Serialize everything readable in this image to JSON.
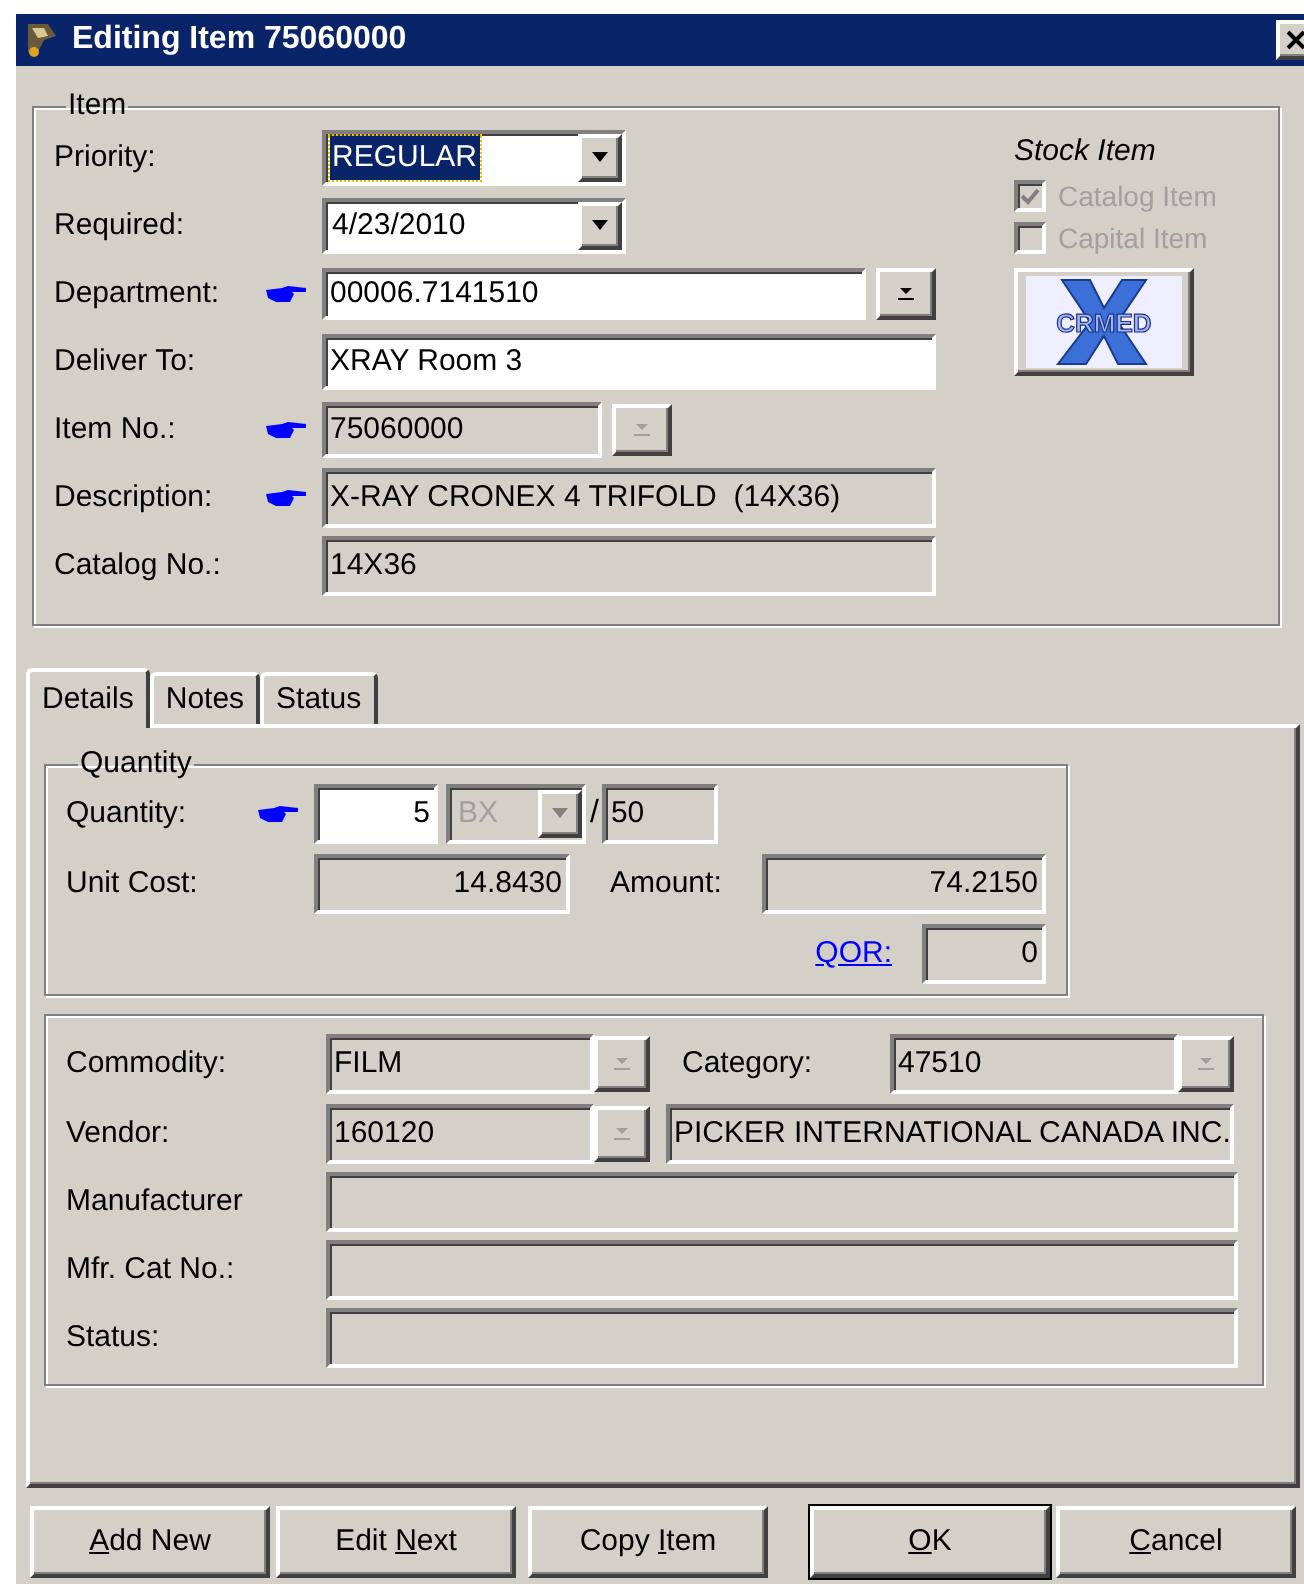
{
  "window": {
    "title": "Editing Item 75060000"
  },
  "item_group": {
    "legend": "Item",
    "fields": [
      {
        "label": "Priority:",
        "value": "REGULAR",
        "kind": "combo",
        "pointer": false,
        "selected": true
      },
      {
        "label": "Required:",
        "value": "4/23/2010",
        "kind": "combo",
        "pointer": false,
        "selected": false
      },
      {
        "label": "Department:",
        "value": "00006.7141510",
        "kind": "lookup",
        "pointer": true,
        "disabled": false
      },
      {
        "label": "Deliver To:",
        "value": "XRAY Room 3",
        "kind": "text",
        "pointer": false
      },
      {
        "label": "Item No.:",
        "value": "75060000",
        "kind": "lookup",
        "pointer": true,
        "disabled": true
      },
      {
        "label": "Description:",
        "value": "X-RAY CRONEX 4 TRIFOLD  (14X36)",
        "kind": "readonly",
        "pointer": true
      },
      {
        "label": "Catalog No.:",
        "value": "14X36",
        "kind": "readonly",
        "pointer": false
      }
    ]
  },
  "stock_item": {
    "title": "Stock Item",
    "options": [
      {
        "label": "Catalog Item",
        "checked": true,
        "disabled": true
      },
      {
        "label": "Capital Item",
        "checked": false,
        "disabled": true
      }
    ],
    "logo": "CRMED"
  },
  "tabs": [
    {
      "label": "Details",
      "selected": true
    },
    {
      "label": "Notes",
      "selected": false
    },
    {
      "label": "Status",
      "selected": false
    }
  ],
  "quantity_group": {
    "legend": "Quantity",
    "quantity_label": "Quantity:",
    "quantity": "5",
    "unit": "BX",
    "separator": "/",
    "pack": "50",
    "unit_cost_label": "Unit Cost:",
    "unit_cost": "14.8430",
    "amount_label": "Amount:",
    "amount": "74.2150",
    "qor_link": "QOR:",
    "qor": "0"
  },
  "source_group": {
    "commodity_label": "Commodity:",
    "commodity": "FILM",
    "category_label": "Category:",
    "category": "47510",
    "vendor_label": "Vendor:",
    "vendor": "160120",
    "vendor_name": "PICKER INTERNATIONAL CANADA INC.",
    "rows": [
      {
        "label": "Manufacturer"
      },
      {
        "label": "Mfr. Cat No.:"
      },
      {
        "label": "Status:"
      }
    ]
  },
  "buttons": [
    {
      "key": "A",
      "post": "dd New",
      "default": false
    },
    {
      "pre": "Edit ",
      "key": "N",
      "post": "ext",
      "default": false
    },
    {
      "pre": "Copy ",
      "key": "I",
      "post": "tem",
      "default": false
    },
    {
      "key": "O",
      "post": "K",
      "default": true
    },
    {
      "key": "C",
      "post": "ancel",
      "default": false
    }
  ]
}
